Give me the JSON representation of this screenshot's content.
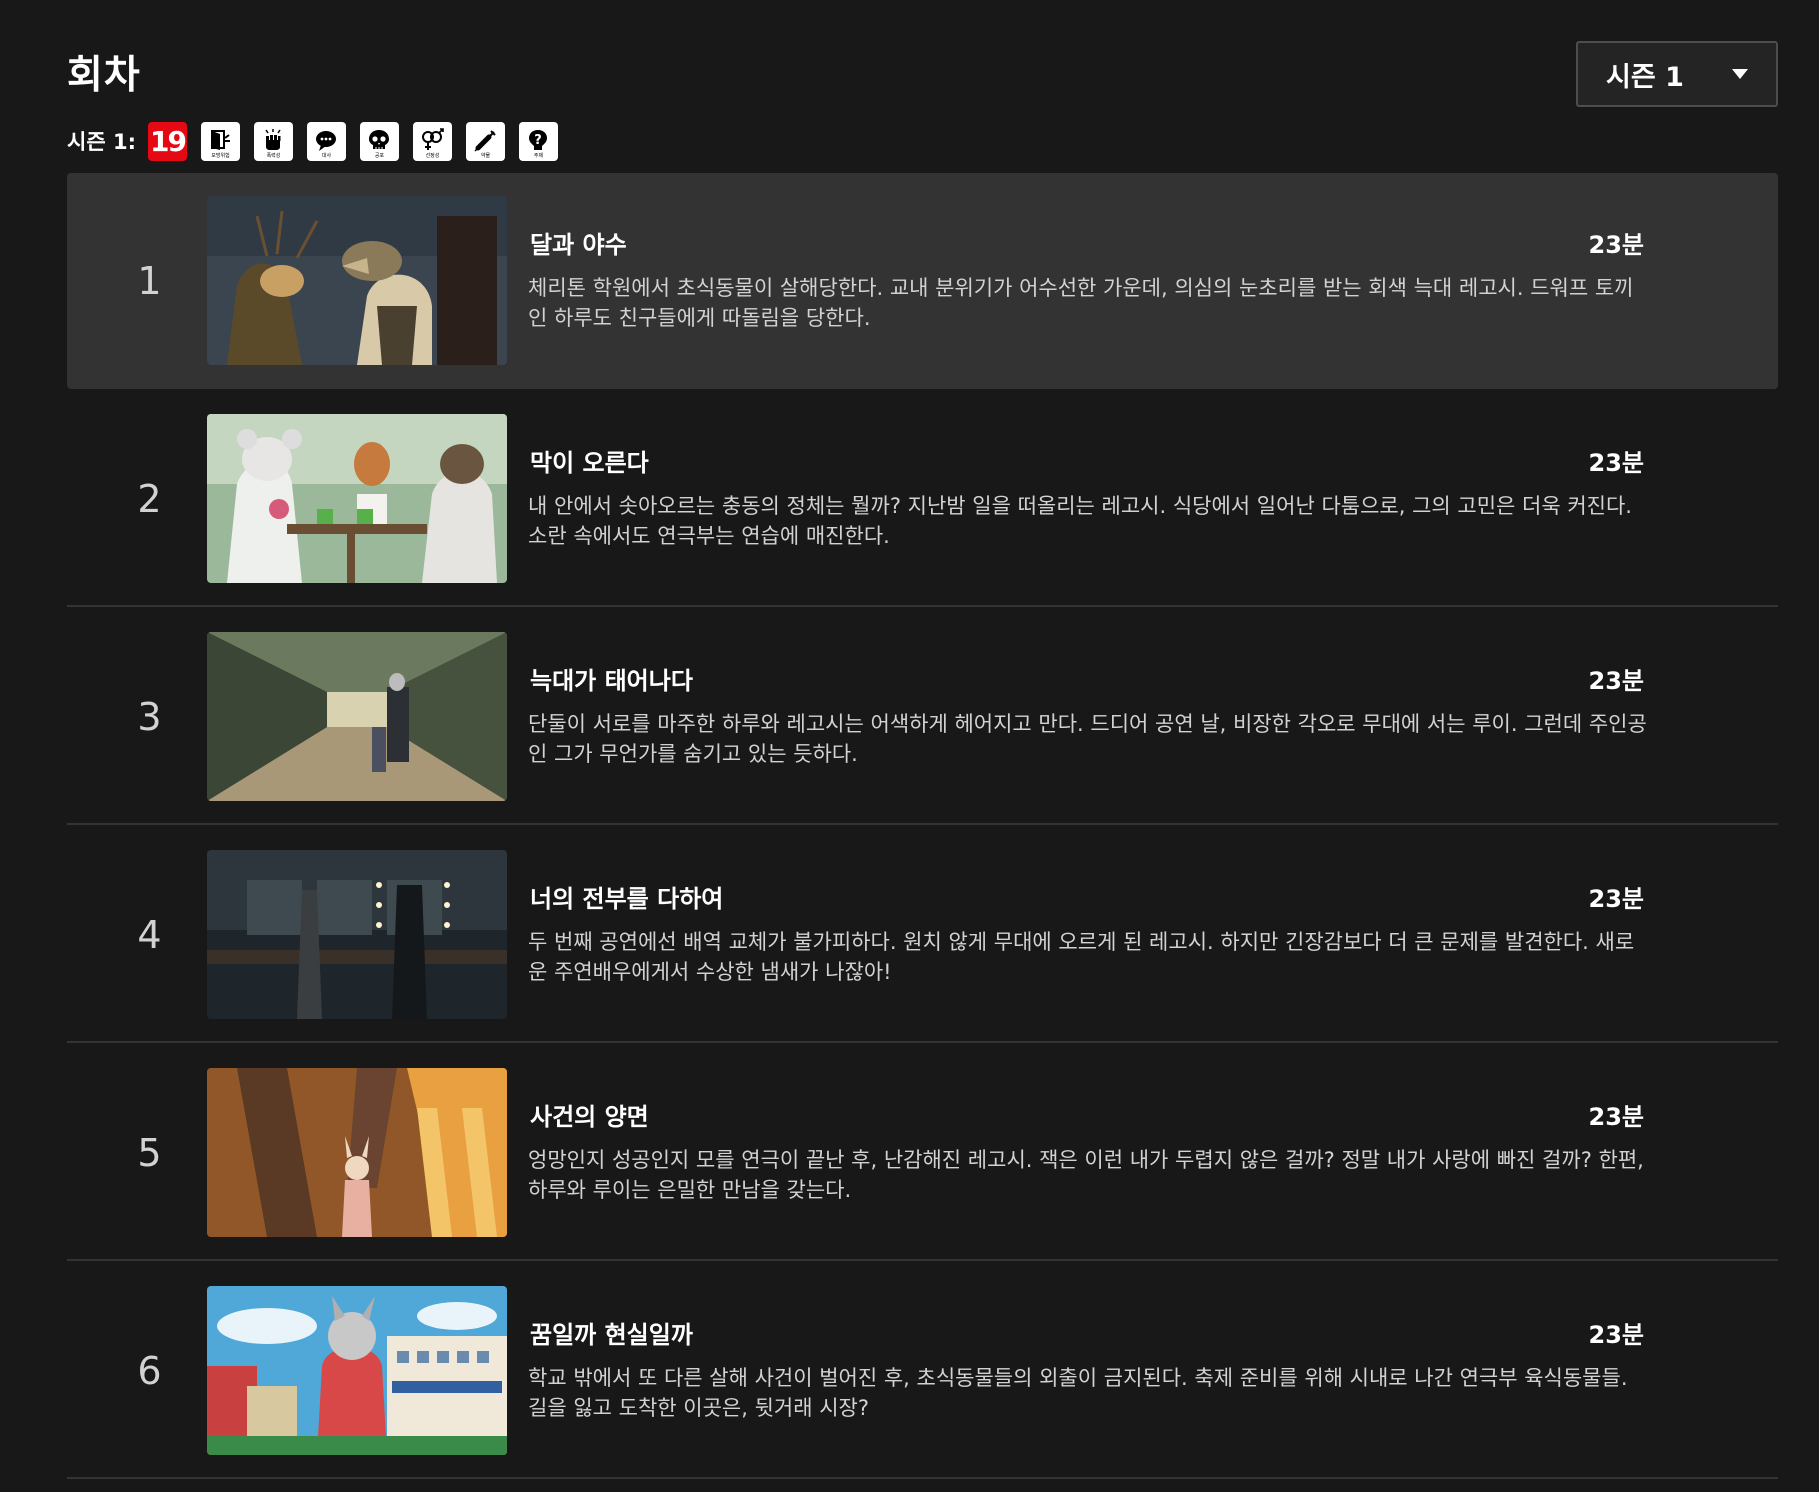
{
  "header": {
    "title": "회차",
    "season_selector": "시즌 1"
  },
  "ratings": {
    "label": "시즌 1:",
    "age": "19",
    "descriptors": [
      {
        "icon": "door-icon",
        "caption": "모방위험"
      },
      {
        "icon": "fist-icon",
        "caption": "폭력성"
      },
      {
        "icon": "speech-bubble-icon",
        "caption": "대사"
      },
      {
        "icon": "skull-icon",
        "caption": "공포"
      },
      {
        "icon": "gender-icon",
        "caption": "선정성"
      },
      {
        "icon": "syringe-icon",
        "caption": "약물"
      },
      {
        "icon": "question-icon",
        "caption": "주제"
      }
    ]
  },
  "episodes": [
    {
      "index": "1",
      "title": "달과 야수",
      "duration": "23분",
      "synopsis": "체리톤 학원에서 초식동물이 살해당한다. 교내 분위기가 어수선한 가운데, 의심의 눈초리를 받는 회색 늑대 레고시. 드워프 토끼인 하루도 친구들에게 따돌림을 당한다."
    },
    {
      "index": "2",
      "title": "막이 오른다",
      "duration": "23분",
      "synopsis": "내 안에서 솟아오르는 충동의 정체는 뭘까? 지난밤 일을 떠올리는 레고시. 식당에서 일어난 다툼으로, 그의 고민은 더욱 커진다. 소란 속에서도 연극부는 연습에 매진한다."
    },
    {
      "index": "3",
      "title": "늑대가 태어나다",
      "duration": "23분",
      "synopsis": "단둘이 서로를 마주한 하루와 레고시는 어색하게 헤어지고 만다. 드디어 공연 날, 비장한 각오로 무대에 서는 루이. 그런데 주인공인 그가 무언가를 숨기고 있는 듯하다."
    },
    {
      "index": "4",
      "title": "너의 전부를 다하여",
      "duration": "23분",
      "synopsis": "두 번째 공연에선 배역 교체가 불가피하다. 원치 않게 무대에 오르게 된 레고시. 하지만 긴장감보다 더 큰 문제를 발견한다. 새로운 주연배우에게서 수상한 냄새가 나잖아!"
    },
    {
      "index": "5",
      "title": "사건의 양면",
      "duration": "23분",
      "synopsis": "엉망인지 성공인지 모를 연극이 끝난 후, 난감해진 레고시. 잭은 이런 내가 두렵지 않은 걸까? 정말 내가 사랑에 빠진 걸까? 한편, 하루와 루이는 은밀한 만남을 갖는다."
    },
    {
      "index": "6",
      "title": "꿈일까 현실일까",
      "duration": "23분",
      "synopsis": "학교 밖에서 또 다른 살해 사건이 벌어진 후, 초식동물들의 외출이 금지된다. 축제 준비를 위해 시내로 나간 연극부 육식동물들. 길을 잃고 도착한 이곳은, 뒷거래 시장?"
    }
  ]
}
